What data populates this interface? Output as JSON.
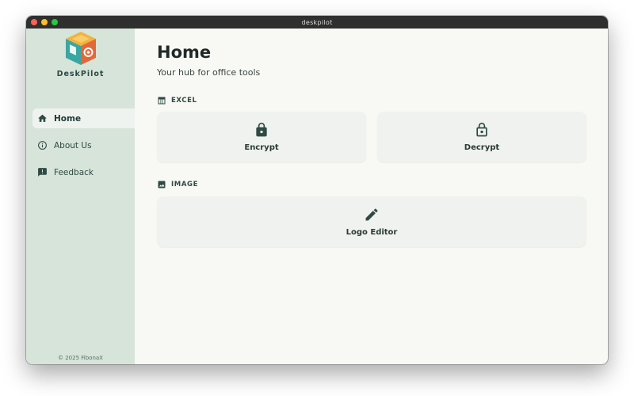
{
  "window": {
    "title": "deskpilot"
  },
  "sidebar": {
    "brand": "DeskPilot",
    "items": [
      {
        "label": "Home",
        "icon": "home-icon",
        "active": true
      },
      {
        "label": "About Us",
        "icon": "info-icon",
        "active": false
      },
      {
        "label": "Feedback",
        "icon": "feedback-icon",
        "active": false
      }
    ],
    "copyright": "© 2025 FibonaX"
  },
  "main": {
    "title": "Home",
    "subtitle": "Your hub for office tools",
    "sections": [
      {
        "title": "EXCEL",
        "icon": "table-icon",
        "cards": [
          {
            "label": "Encrypt",
            "icon": "lock-icon"
          },
          {
            "label": "Decrypt",
            "icon": "unlock-icon"
          }
        ]
      },
      {
        "title": "IMAGE",
        "icon": "image-icon",
        "cards": [
          {
            "label": "Logo Editor",
            "icon": "pencil-icon"
          }
        ]
      }
    ]
  },
  "colors": {
    "sidebar_bg": "#d7e4da",
    "main_bg": "#f8f8f4",
    "accent": "#2f4a44",
    "card_bg": "#eff2ee"
  }
}
